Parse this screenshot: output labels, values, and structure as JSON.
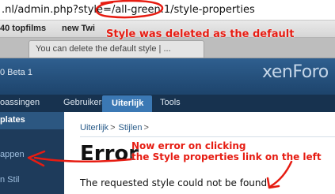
{
  "browser": {
    "address_url": ".nl/admin.php?style=/all-green.1/style-properties",
    "bookmarks": [
      "40 topfilms",
      "new Twi"
    ],
    "tab_title": "You can delete the default style | ..."
  },
  "xenforo": {
    "version_text": "0 Beta 1",
    "logo_text": "xenForo",
    "nav_tabs": [
      "oassingen",
      "Gebruikers",
      "Uiterlijk",
      "Tools"
    ],
    "active_tab_index": 2,
    "sidebar_heading": "plates",
    "sidebar_items": [
      "appen",
      "n Stil"
    ],
    "breadcrumbs": [
      "Uiterlijk",
      "Stijlen"
    ],
    "breadcrumb_separator": ">",
    "page_title": "Error",
    "error_message": "The requested style could not be found."
  },
  "annotations": {
    "note_1": "Style was deleted as the default",
    "note_2_line_1": "Now error on clicking",
    "note_2_line_2": "the Style properties link on the left",
    "ink_color": "#e61c12"
  },
  "colors": {
    "header_blue": "#2f5f8f",
    "nav_dark": "#17324f",
    "active_tab": "#3b78b4",
    "sidebar": "#1e3b5b",
    "link_blue": "#2a5c8a"
  }
}
